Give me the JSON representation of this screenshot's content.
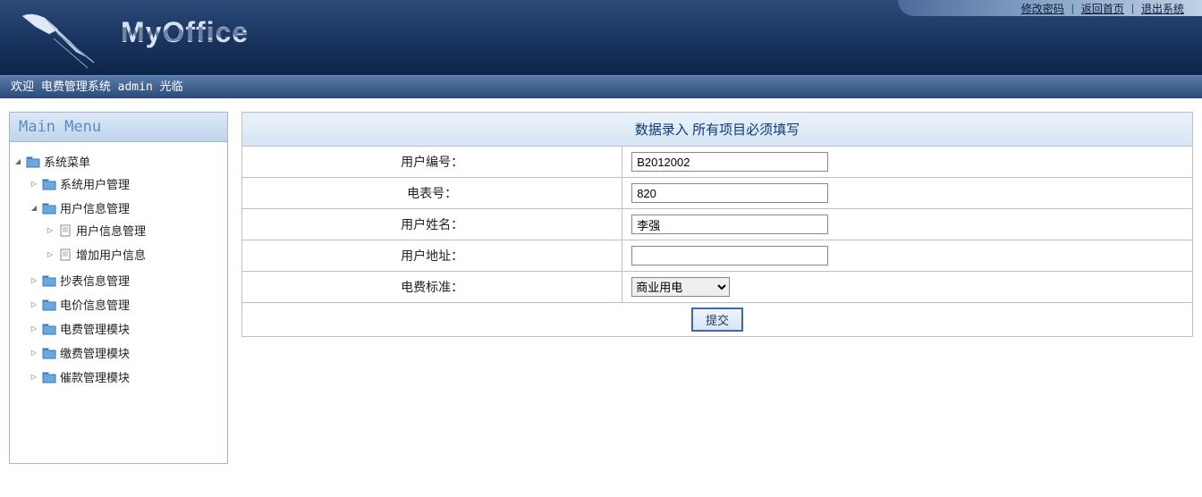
{
  "header": {
    "links": {
      "change_password": "修改密码",
      "home": "返回首页",
      "logout": "退出系统"
    },
    "logo": "MyOffice"
  },
  "welcome": "欢迎 电费管理系统 admin 光临",
  "sidebar": {
    "title": "Main Menu",
    "root": "系统菜单",
    "items": {
      "sys_user_mgmt": "系统用户管理",
      "user_info_mgmt": "用户信息管理",
      "user_info_mgmt_sub": "用户信息管理",
      "add_user_info": "增加用户信息",
      "meter_read_mgmt": "抄表信息管理",
      "price_info_mgmt": "电价信息管理",
      "fee_mgmt_module": "电费管理模块",
      "payment_module": "缴费管理模块",
      "reminder_module": "催款管理模块"
    }
  },
  "form": {
    "header": "数据录入 所有项目必须填写",
    "labels": {
      "user_id": "用户编号：",
      "meter_no": "电表号：",
      "user_name": "用户姓名：",
      "user_address": "用户地址：",
      "fee_standard": "电费标准："
    },
    "values": {
      "user_id": "B2012002",
      "meter_no": "820",
      "user_name": "李强",
      "user_address": "",
      "fee_standard": "商业用电"
    },
    "submit": "提交"
  }
}
